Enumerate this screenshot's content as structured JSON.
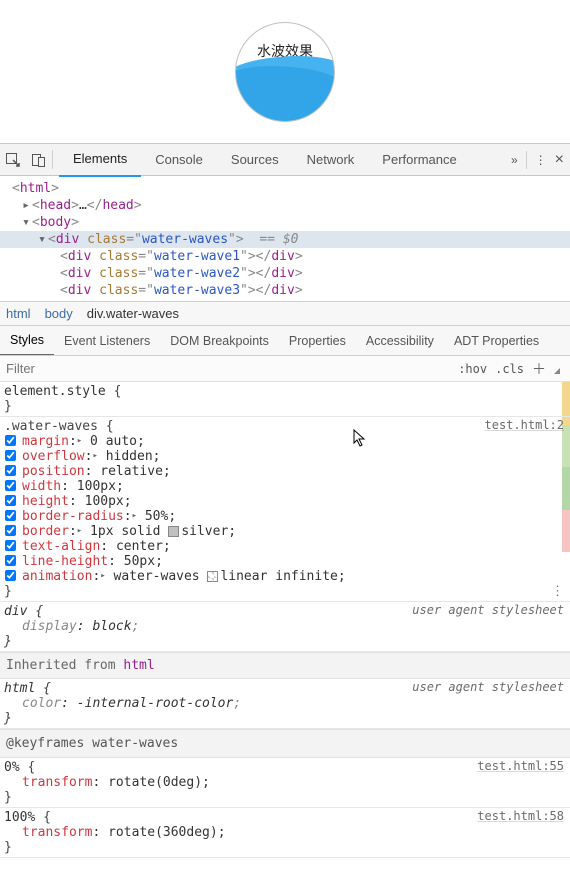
{
  "preview": {
    "label": "水波效果"
  },
  "tabs": {
    "items": [
      "Elements",
      "Console",
      "Sources",
      "Network",
      "Performance"
    ],
    "overflow": "»",
    "kebab": "⋮",
    "close": "×"
  },
  "dom": {
    "html_open": "html",
    "head_open": "head",
    "head_ellipsis": "…",
    "head_close": "head",
    "body": "body",
    "div": "div",
    "class_attr": "class",
    "water_waves": "water-waves",
    "water_wave1": "water-wave1",
    "water_wave2": "water-wave2",
    "water_wave3": "water-wave3",
    "eq_marker": "== $0",
    "quote": "\""
  },
  "breadcrumb": {
    "items": [
      "html",
      "body",
      "div.water-waves"
    ]
  },
  "sub_tabs": {
    "items": [
      "Styles",
      "Event Listeners",
      "DOM Breakpoints",
      "Properties",
      "Accessibility",
      "ADT Properties"
    ]
  },
  "filter": {
    "placeholder": "Filter",
    "hov": ":hov",
    "cls": ".cls"
  },
  "styles": {
    "element_style": "element.style",
    "water_waves_sel": ".water-waves",
    "src1": "test.html:2",
    "decls": [
      {
        "name": "margin",
        "tri": true,
        "val": "0 auto"
      },
      {
        "name": "overflow",
        "tri": true,
        "val": "hidden"
      },
      {
        "name": "position",
        "val": "relative"
      },
      {
        "name": "width",
        "val": "100px"
      },
      {
        "name": "height",
        "val": "100px"
      },
      {
        "name": "border-radius",
        "tri": true,
        "val": "50%"
      },
      {
        "name": "border",
        "tri": true,
        "sw": "silver",
        "val": "1px solid ",
        "val2": "silver"
      },
      {
        "name": "text-align",
        "val": "center"
      },
      {
        "name": "line-height",
        "val": "50px"
      },
      {
        "name": "animation",
        "tri": true,
        "val": "water-waves ",
        "sw": "check",
        "val2": "linear infinite"
      }
    ],
    "div_sel": "div",
    "ua_label": "user agent stylesheet",
    "display_block": {
      "name": "display",
      "val": "block"
    },
    "inherited_from": "Inherited from",
    "inherited_tag": "html",
    "html_sel": "html",
    "color_decl": {
      "name": "color",
      "val": "-internal-root-color"
    },
    "kf_hdr": "@keyframes water-waves",
    "kf0": {
      "sel": "0%",
      "src": "test.html:55",
      "name": "transform",
      "val": "rotate(0deg)"
    },
    "kf100": {
      "sel": "100%",
      "src": "test.html:58",
      "name": "transform",
      "val": "rotate(360deg)"
    }
  }
}
